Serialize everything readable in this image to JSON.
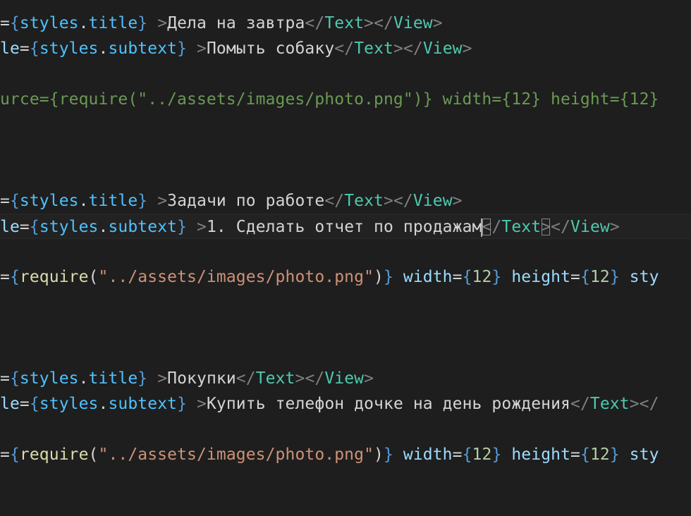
{
  "lines": [
    {
      "current": false,
      "tokens": [
        {
          "c": "punct",
          "t": "="
        },
        {
          "c": "brace",
          "t": "{"
        },
        {
          "c": "prop",
          "t": "styles"
        },
        {
          "c": "punct",
          "t": "."
        },
        {
          "c": "prop",
          "t": "title"
        },
        {
          "c": "brace",
          "t": "}"
        },
        {
          "c": "text",
          "t": " "
        },
        {
          "c": "gray",
          "t": ">"
        },
        {
          "c": "text",
          "t": "Дела на завтра"
        },
        {
          "c": "gray",
          "t": "</"
        },
        {
          "c": "tag",
          "t": "Text"
        },
        {
          "c": "gray",
          "t": "></"
        },
        {
          "c": "tag",
          "t": "View"
        },
        {
          "c": "gray",
          "t": ">"
        }
      ]
    },
    {
      "current": false,
      "tokens": [
        {
          "c": "attr",
          "t": "le"
        },
        {
          "c": "punct",
          "t": "="
        },
        {
          "c": "brace",
          "t": "{"
        },
        {
          "c": "prop",
          "t": "styles"
        },
        {
          "c": "punct",
          "t": "."
        },
        {
          "c": "prop",
          "t": "subtext"
        },
        {
          "c": "brace",
          "t": "}"
        },
        {
          "c": "text",
          "t": " "
        },
        {
          "c": "gray",
          "t": ">"
        },
        {
          "c": "text",
          "t": "Помыть собаку"
        },
        {
          "c": "gray",
          "t": "</"
        },
        {
          "c": "tag",
          "t": "Text"
        },
        {
          "c": "gray",
          "t": "></"
        },
        {
          "c": "tag",
          "t": "View"
        },
        {
          "c": "gray",
          "t": ">"
        }
      ]
    },
    {
      "current": false,
      "tokens": []
    },
    {
      "current": false,
      "tokens": [
        {
          "c": "comment",
          "t": "urce={require(\"../assets/images/photo.png\")} width={12} height={12}"
        }
      ]
    },
    {
      "current": false,
      "tokens": []
    },
    {
      "current": false,
      "tokens": []
    },
    {
      "current": false,
      "tokens": []
    },
    {
      "current": false,
      "tokens": [
        {
          "c": "punct",
          "t": "="
        },
        {
          "c": "brace",
          "t": "{"
        },
        {
          "c": "prop",
          "t": "styles"
        },
        {
          "c": "punct",
          "t": "."
        },
        {
          "c": "prop",
          "t": "title"
        },
        {
          "c": "brace",
          "t": "}"
        },
        {
          "c": "text",
          "t": " "
        },
        {
          "c": "gray",
          "t": ">"
        },
        {
          "c": "text",
          "t": "Задачи по работе"
        },
        {
          "c": "gray",
          "t": "</"
        },
        {
          "c": "tag",
          "t": "Text"
        },
        {
          "c": "gray",
          "t": "></"
        },
        {
          "c": "tag",
          "t": "View"
        },
        {
          "c": "gray",
          "t": ">"
        }
      ]
    },
    {
      "current": true,
      "tokens": [
        {
          "c": "attr",
          "t": "le"
        },
        {
          "c": "punct",
          "t": "="
        },
        {
          "c": "brace",
          "t": "{"
        },
        {
          "c": "prop",
          "t": "styles"
        },
        {
          "c": "punct",
          "t": "."
        },
        {
          "c": "prop",
          "t": "subtext"
        },
        {
          "c": "brace",
          "t": "}"
        },
        {
          "c": "text",
          "t": " "
        },
        {
          "c": "gray",
          "t": ">"
        },
        {
          "c": "text",
          "t": "1. Сделать отчет по продажам"
        },
        {
          "c": "cursor",
          "t": ""
        },
        {
          "c": "gray match",
          "t": "<"
        },
        {
          "c": "gray",
          "t": "/"
        },
        {
          "c": "tag",
          "t": "Text"
        },
        {
          "c": "gray match",
          "t": ">"
        },
        {
          "c": "gray",
          "t": "</"
        },
        {
          "c": "tag",
          "t": "View"
        },
        {
          "c": "gray",
          "t": ">"
        }
      ]
    },
    {
      "current": false,
      "tokens": []
    },
    {
      "current": false,
      "tokens": [
        {
          "c": "punct",
          "t": "="
        },
        {
          "c": "brace",
          "t": "{"
        },
        {
          "c": "func",
          "t": "require"
        },
        {
          "c": "punct",
          "t": "("
        },
        {
          "c": "string",
          "t": "\"../assets/images/photo.png\""
        },
        {
          "c": "punct",
          "t": ")"
        },
        {
          "c": "brace",
          "t": "}"
        },
        {
          "c": "text",
          "t": " "
        },
        {
          "c": "attr",
          "t": "width"
        },
        {
          "c": "punct",
          "t": "="
        },
        {
          "c": "brace",
          "t": "{"
        },
        {
          "c": "number",
          "t": "12"
        },
        {
          "c": "brace",
          "t": "}"
        },
        {
          "c": "text",
          "t": " "
        },
        {
          "c": "attr",
          "t": "height"
        },
        {
          "c": "punct",
          "t": "="
        },
        {
          "c": "brace",
          "t": "{"
        },
        {
          "c": "number",
          "t": "12"
        },
        {
          "c": "brace",
          "t": "}"
        },
        {
          "c": "text",
          "t": " "
        },
        {
          "c": "attr",
          "t": "sty"
        }
      ]
    },
    {
      "current": false,
      "tokens": []
    },
    {
      "current": false,
      "tokens": []
    },
    {
      "current": false,
      "tokens": []
    },
    {
      "current": false,
      "tokens": [
        {
          "c": "punct",
          "t": "="
        },
        {
          "c": "brace",
          "t": "{"
        },
        {
          "c": "prop",
          "t": "styles"
        },
        {
          "c": "punct",
          "t": "."
        },
        {
          "c": "prop",
          "t": "title"
        },
        {
          "c": "brace",
          "t": "}"
        },
        {
          "c": "text",
          "t": " "
        },
        {
          "c": "gray",
          "t": ">"
        },
        {
          "c": "text",
          "t": "Покупки"
        },
        {
          "c": "gray",
          "t": "</"
        },
        {
          "c": "tag",
          "t": "Text"
        },
        {
          "c": "gray",
          "t": "></"
        },
        {
          "c": "tag",
          "t": "View"
        },
        {
          "c": "gray",
          "t": ">"
        }
      ]
    },
    {
      "current": false,
      "tokens": [
        {
          "c": "attr",
          "t": "le"
        },
        {
          "c": "punct",
          "t": "="
        },
        {
          "c": "brace",
          "t": "{"
        },
        {
          "c": "prop",
          "t": "styles"
        },
        {
          "c": "punct",
          "t": "."
        },
        {
          "c": "prop",
          "t": "subtext"
        },
        {
          "c": "brace",
          "t": "}"
        },
        {
          "c": "text",
          "t": " "
        },
        {
          "c": "gray",
          "t": ">"
        },
        {
          "c": "text",
          "t": "Купить телефон дочке на день рождения"
        },
        {
          "c": "gray",
          "t": "</"
        },
        {
          "c": "tag",
          "t": "Text"
        },
        {
          "c": "gray",
          "t": "></"
        }
      ]
    },
    {
      "current": false,
      "tokens": []
    },
    {
      "current": false,
      "tokens": [
        {
          "c": "punct",
          "t": "="
        },
        {
          "c": "brace",
          "t": "{"
        },
        {
          "c": "func",
          "t": "require"
        },
        {
          "c": "punct",
          "t": "("
        },
        {
          "c": "string",
          "t": "\"../assets/images/photo.png\""
        },
        {
          "c": "punct",
          "t": ")"
        },
        {
          "c": "brace",
          "t": "}"
        },
        {
          "c": "text",
          "t": " "
        },
        {
          "c": "attr",
          "t": "width"
        },
        {
          "c": "punct",
          "t": "="
        },
        {
          "c": "brace",
          "t": "{"
        },
        {
          "c": "number",
          "t": "12"
        },
        {
          "c": "brace",
          "t": "}"
        },
        {
          "c": "text",
          "t": " "
        },
        {
          "c": "attr",
          "t": "height"
        },
        {
          "c": "punct",
          "t": "="
        },
        {
          "c": "brace",
          "t": "{"
        },
        {
          "c": "number",
          "t": "12"
        },
        {
          "c": "brace",
          "t": "}"
        },
        {
          "c": "text",
          "t": " "
        },
        {
          "c": "attr",
          "t": "sty"
        }
      ]
    },
    {
      "current": false,
      "tokens": []
    },
    {
      "current": false,
      "tokens": []
    }
  ]
}
